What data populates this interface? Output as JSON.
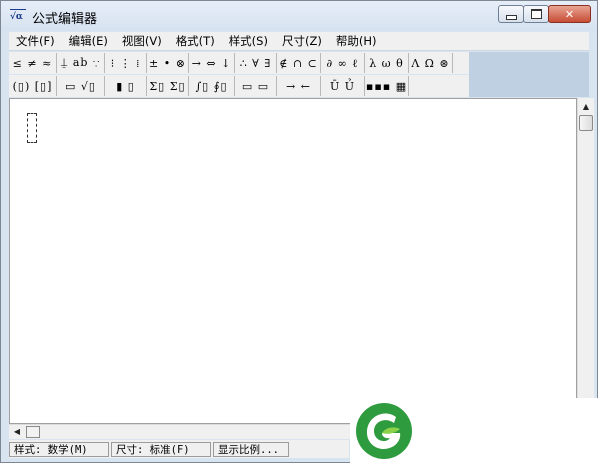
{
  "window": {
    "title": "公式编辑器",
    "app_icon_text": "√α"
  },
  "menu": [
    "文件(F)",
    "编辑(E)",
    "视图(V)",
    "格式(T)",
    "样式(S)",
    "尺寸(Z)",
    "帮助(H)"
  ],
  "toolbar_row1": [
    "≤ ≠ ≈",
    "⍊ ab ∵",
    "⁝ ⋮ ⁞",
    "± • ⊗",
    "→ ⇔ ↓",
    "∴ ∀ ∃",
    "∉ ∩ ⊂",
    "∂ ∞ ℓ",
    "λ ω θ",
    "Λ Ω ⊛"
  ],
  "toolbar_row2": [
    "(▯) [▯]",
    "▭ √▯",
    "▮ ▯",
    "Σ▯ Σ▯",
    "∫▯ ∮▯",
    "▭ ▭",
    "→ ←",
    "Ū Ủ",
    "▪▪▪ ▦"
  ],
  "status": {
    "style": "样式: 数学(M)",
    "size": "尺寸: 标准(F)",
    "zoom": "显示比例..."
  },
  "colors": {
    "title_bg": "#d6e2f0",
    "close_button": "#c74d36",
    "logo_green": "#2e9b3e"
  }
}
